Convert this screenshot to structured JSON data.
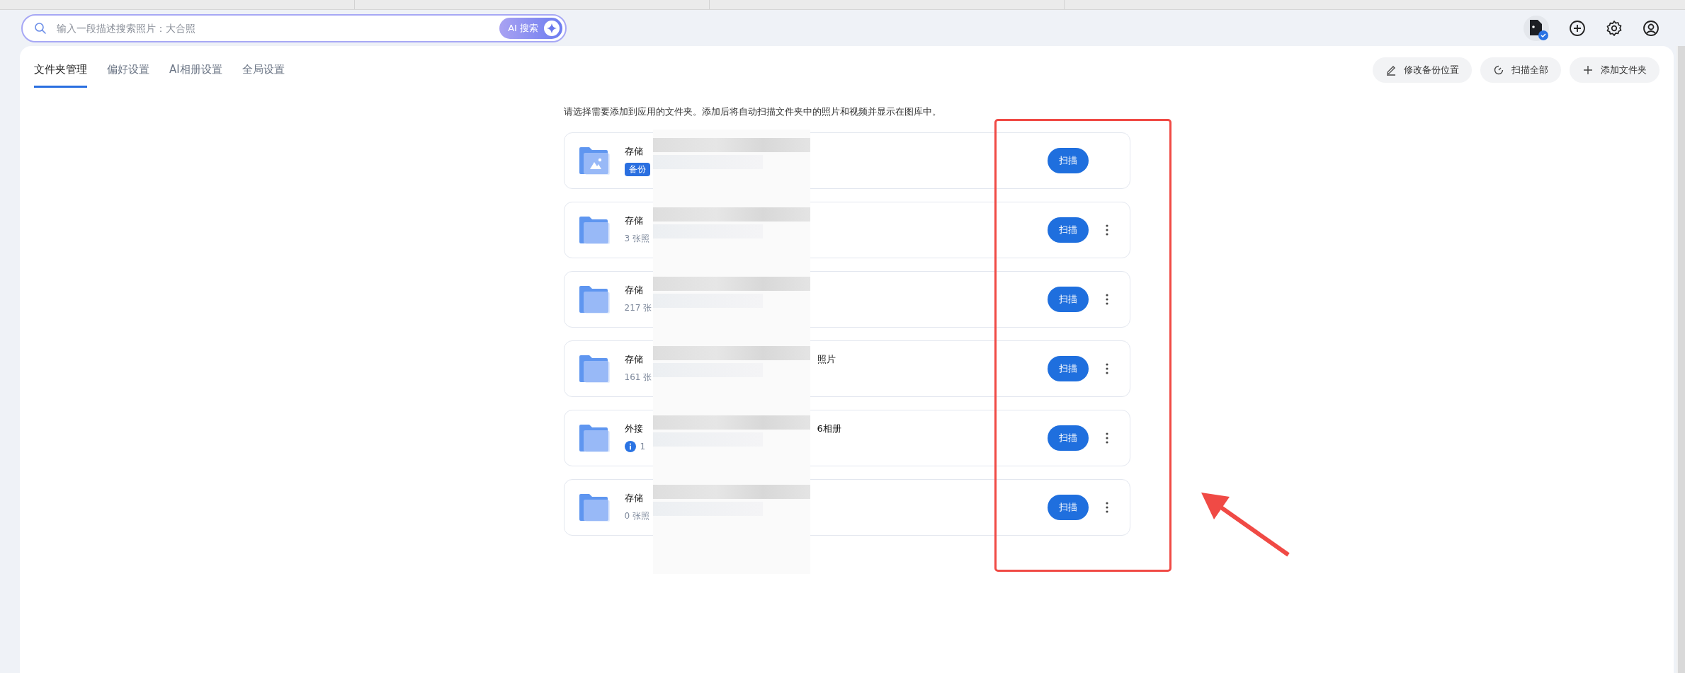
{
  "search": {
    "placeholder": "输入一段描述搜索照片：大合照",
    "ai_button": "AI 搜索"
  },
  "tabs": [
    {
      "label": "文件夹管理",
      "selected": true
    },
    {
      "label": "偏好设置",
      "selected": false
    },
    {
      "label": "AI相册设置",
      "selected": false
    },
    {
      "label": "全局设置",
      "selected": false
    }
  ],
  "actions": [
    {
      "kind": "edit",
      "label": "修改备份位置"
    },
    {
      "kind": "scan",
      "label": "扫描全部"
    },
    {
      "kind": "add",
      "label": "添加文件夹"
    }
  ],
  "description": "请选择需要添加到应用的文件夹。添加后将自动扫描文件夹中的照片和视频并显示在图库中。",
  "folders": [
    {
      "kind": "photo",
      "title": "存储",
      "sub": {
        "kind": "tag",
        "text": "备份"
      },
      "scan_label": "扫描",
      "menu": false
    },
    {
      "kind": "folder",
      "title": "存储",
      "sub": {
        "kind": "text",
        "text": "3 张照"
      },
      "scan_label": "扫描",
      "menu": true
    },
    {
      "kind": "folder",
      "title": "存储",
      "sub": {
        "kind": "text",
        "text": "217 张"
      },
      "scan_label": "扫描",
      "menu": true
    },
    {
      "kind": "folder",
      "title": "存储",
      "title_end": "照片",
      "sub": {
        "kind": "text",
        "text": "161 张"
      },
      "scan_label": "扫描",
      "menu": true
    },
    {
      "kind": "folder",
      "title": "外接",
      "title_end": "6相册",
      "sub": {
        "kind": "info",
        "text": "1"
      },
      "scan_label": "扫描",
      "menu": true
    },
    {
      "kind": "folder",
      "title": "存储",
      "sub": {
        "kind": "text",
        "text": "0 张照"
      },
      "scan_label": "扫描",
      "menu": true
    }
  ]
}
